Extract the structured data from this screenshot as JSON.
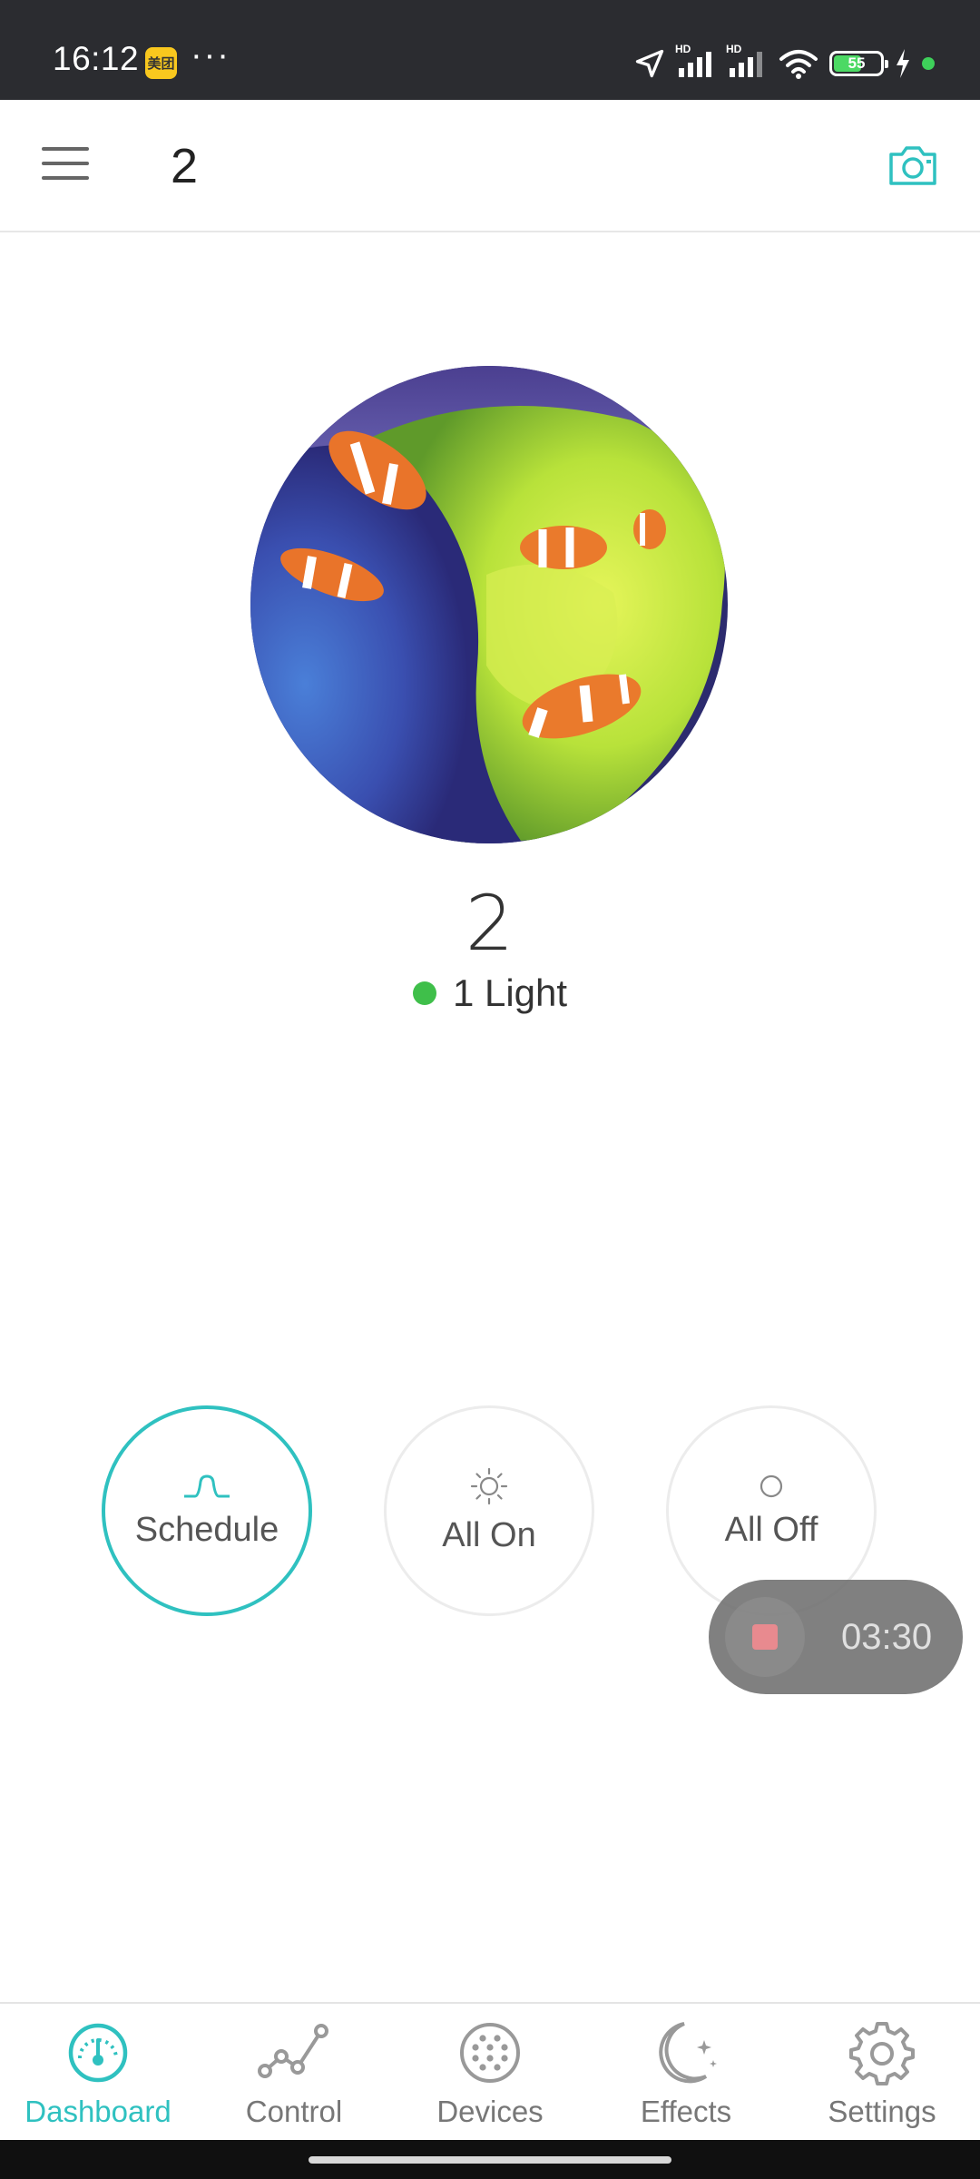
{
  "status_bar": {
    "time": "16:12",
    "app_badge": "美团",
    "overflow": "···",
    "battery_level": "55",
    "hd_label": "HD",
    "icons": [
      "location-icon",
      "signal-icon",
      "signal-icon",
      "wifi-icon",
      "battery-icon",
      "charging-icon"
    ],
    "dot_color": "#3ed05a"
  },
  "app_bar": {
    "title": "2",
    "menu_icon": "menu-icon",
    "camera_icon": "camera-icon",
    "accent": "#2fc1c0"
  },
  "group": {
    "image": "clownfish-anemone-photo",
    "name": "2",
    "light_count": "1 Light",
    "status_color": "#3fbf4a"
  },
  "modes": [
    {
      "id": "schedule",
      "label": "Schedule",
      "icon": "schedule-curve-icon",
      "active": true
    },
    {
      "id": "all_on",
      "label": "All On",
      "icon": "sun-icon",
      "active": false
    },
    {
      "id": "all_off",
      "label": "All Off",
      "icon": "circle-off-icon",
      "active": false
    }
  ],
  "recording": {
    "elapsed": "03:30",
    "stop_icon": "stop-icon"
  },
  "bottom_nav": [
    {
      "label": "Dashboard",
      "icon": "dashboard-gauge-icon",
      "active": true
    },
    {
      "label": "Control",
      "icon": "control-chart-icon",
      "active": false
    },
    {
      "label": "Devices",
      "icon": "devices-dots-icon",
      "active": false
    },
    {
      "label": "Effects",
      "icon": "moon-stars-icon",
      "active": false
    },
    {
      "label": "Settings",
      "icon": "gear-icon",
      "active": false
    }
  ]
}
